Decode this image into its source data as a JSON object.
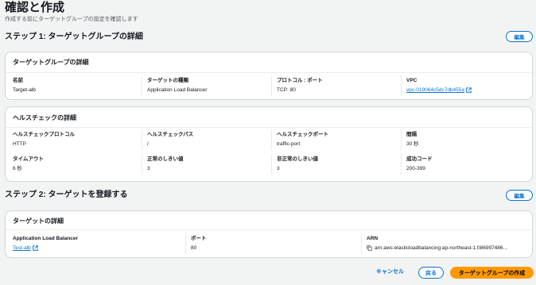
{
  "page": {
    "title": "確認と作成",
    "subtitle": "作成する前にターゲットグループの設定を確認します"
  },
  "step1": {
    "heading": "ステップ 1: ターゲットグループの詳細",
    "edit_label": "編集",
    "details_card": {
      "title": "ターゲットグループの詳細",
      "fields": [
        {
          "label": "名前",
          "value": "Target-alb"
        },
        {
          "label": "ターゲットの種類",
          "value": "Application Load Balancer"
        },
        {
          "label": "プロトコル : ポート",
          "value": "TCP: 80"
        },
        {
          "label": "VPC",
          "value": "vpc-019064c5dc7db455a"
        }
      ]
    },
    "health_card": {
      "title": "ヘルスチェックの詳細",
      "row1": [
        {
          "label": "ヘルスチェックプロトコル",
          "value": "HTTP"
        },
        {
          "label": "ヘルスチェックパス",
          "value": "/"
        },
        {
          "label": "ヘルスチェックポート",
          "value": "traffic-port"
        },
        {
          "label": "間隔",
          "value": "30 秒"
        }
      ],
      "row2": [
        {
          "label": "タイムアウト",
          "value": "6 秒"
        },
        {
          "label": "正常のしきい値",
          "value": "3"
        },
        {
          "label": "非正常のしきい値",
          "value": "3"
        },
        {
          "label": "成功コード",
          "value": "200-399"
        }
      ]
    }
  },
  "step2": {
    "heading": "ステップ 2: ターゲットを登録する",
    "edit_label": "編集",
    "targets_card": {
      "title": "ターゲットの詳細",
      "fields": [
        {
          "label": "Application Load Balancer",
          "value": "Test-alb"
        },
        {
          "label": "ポート",
          "value": "80"
        },
        {
          "label": "ARN",
          "value": "arn:aws:elasticloadbalancing:ap-northeast-1:086997486..."
        }
      ]
    }
  },
  "footer": {
    "cancel_label": "キャンセル",
    "back_label": "戻る",
    "create_label": "ターゲットグループの作成"
  },
  "colors": {
    "link": "#0972d3",
    "primary_button": "#ff9900",
    "background": "#f2f3f3"
  }
}
